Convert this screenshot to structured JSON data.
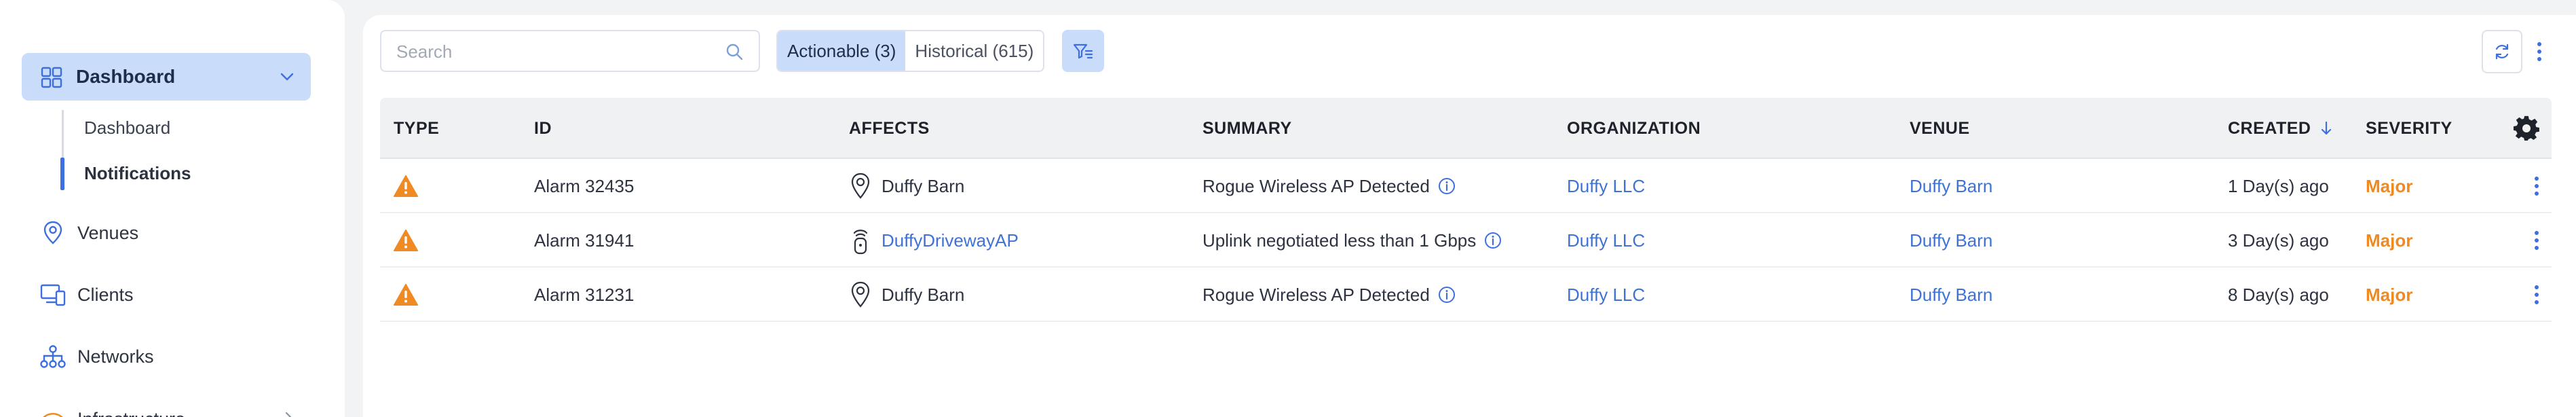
{
  "sidebar": {
    "dashboard_label": "Dashboard",
    "sub_items": [
      "Dashboard",
      "Notifications"
    ],
    "items": [
      {
        "label": "Venues",
        "icon": "location-pin-icon"
      },
      {
        "label": "Clients",
        "icon": "devices-icon"
      },
      {
        "label": "Networks",
        "icon": "network-icon"
      },
      {
        "label": "Infrastructure",
        "icon": "wifi-icon"
      }
    ]
  },
  "toolbar": {
    "search_placeholder": "Search",
    "actionable_label": "Actionable (3)",
    "historical_label": "Historical (615)"
  },
  "table": {
    "headers": {
      "type": "TYPE",
      "id": "ID",
      "affects": "AFFECTS",
      "summary": "SUMMARY",
      "organization": "ORGANIZATION",
      "venue": "VENUE",
      "created": "CREATED",
      "severity": "SEVERITY"
    },
    "rows": [
      {
        "id": "Alarm 32435",
        "affects": "Duffy Barn",
        "affects_type": "venue",
        "summary": "Rogue Wireless AP Detected",
        "organization": "Duffy LLC",
        "venue": "Duffy Barn",
        "created": "1 Day(s) ago",
        "severity": "Major"
      },
      {
        "id": "Alarm 31941",
        "affects": "DuffyDrivewayAP",
        "affects_type": "access-point",
        "summary": "Uplink negotiated less than 1 Gbps",
        "organization": "Duffy LLC",
        "venue": "Duffy Barn",
        "created": "3 Day(s) ago",
        "severity": "Major"
      },
      {
        "id": "Alarm 31231",
        "affects": "Duffy Barn",
        "affects_type": "venue",
        "summary": "Rogue Wireless AP Detected",
        "organization": "Duffy LLC",
        "venue": "Duffy Barn",
        "created": "8 Day(s) ago",
        "severity": "Major"
      }
    ]
  },
  "colors": {
    "accent": "#3f72d4",
    "selected_bg": "#c9dcf9",
    "warning": "#f08a24",
    "major": "#ef8a23"
  }
}
